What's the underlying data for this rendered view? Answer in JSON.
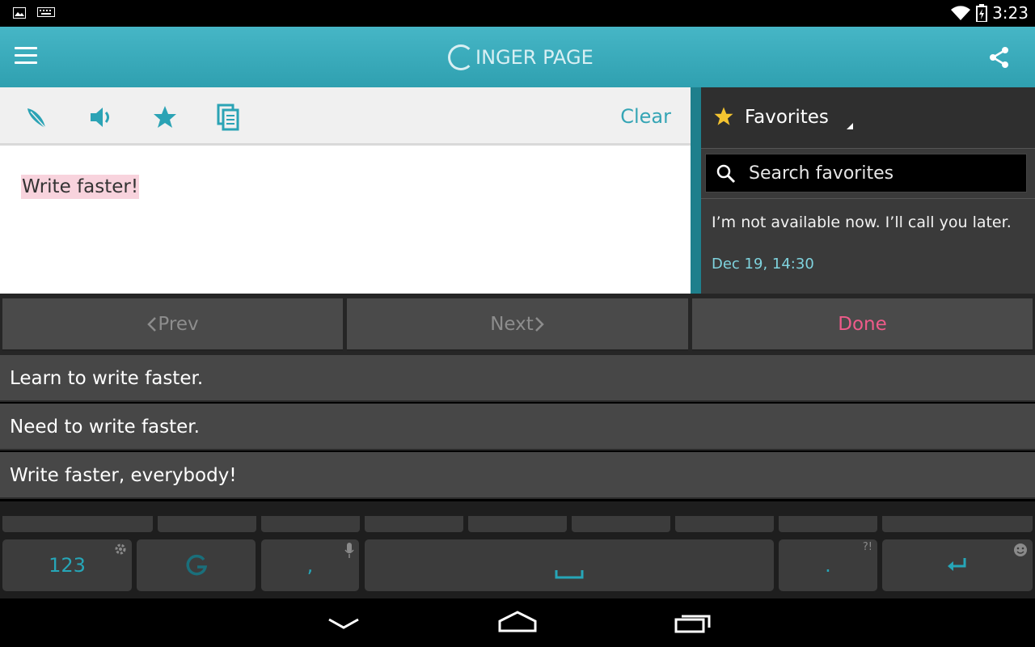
{
  "status_bar": {
    "time": "3:23",
    "left_icons": [
      "image-notification-icon",
      "keyboard-notification-icon"
    ],
    "right_icons": [
      "wifi-icon",
      "battery-icon"
    ]
  },
  "app_bar": {
    "logo_text": "INGER PAGE",
    "menu_icon": "hamburger-menu-icon",
    "share_icon": "share-icon",
    "brand_color": "#3aaebe"
  },
  "toolbar": {
    "icons": [
      "feather-icon",
      "speaker-icon",
      "star-icon",
      "copy-icon"
    ],
    "clear_label": "Clear"
  },
  "editor": {
    "text": "Write faster!"
  },
  "favorites": {
    "title": "Favorites",
    "search_placeholder": "Search favorites",
    "items": [
      {
        "message": "I’m not available now. I’ll call you later.",
        "date": "Dec 19, 14:30"
      }
    ]
  },
  "nav_buttons": {
    "prev": "Prev",
    "next": "Next",
    "done": "Done"
  },
  "suggestions": [
    "Learn to write faster.",
    "Need to write faster.",
    "Write faster, everybody!"
  ],
  "keyboard": {
    "numbers_key": "123",
    "comma_key": ",",
    "period_key": ".",
    "period_hint": "?!",
    "space_icon": "space-bar-icon",
    "enter_icon": "enter-icon",
    "accent_color": "#26a6b8"
  },
  "system_nav": [
    "back-icon",
    "home-icon",
    "recents-icon"
  ]
}
